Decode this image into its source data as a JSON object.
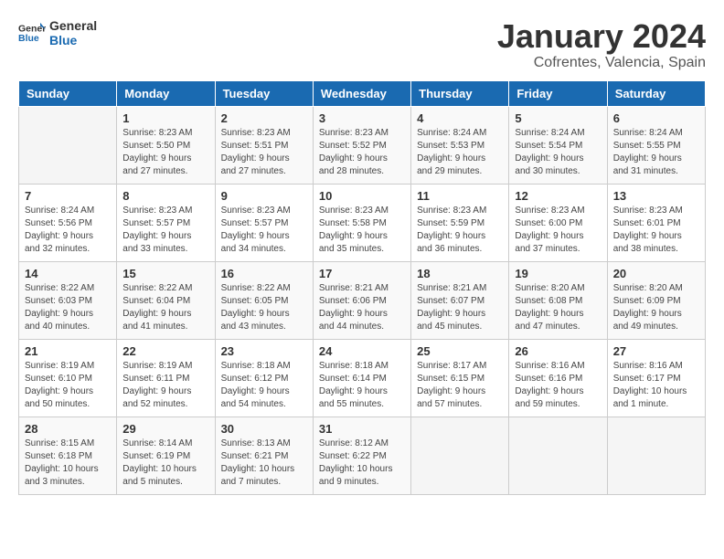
{
  "header": {
    "logo_line1": "General",
    "logo_line2": "Blue",
    "title": "January 2024",
    "subtitle": "Cofrentes, Valencia, Spain"
  },
  "columns": [
    "Sunday",
    "Monday",
    "Tuesday",
    "Wednesday",
    "Thursday",
    "Friday",
    "Saturday"
  ],
  "weeks": [
    [
      {
        "day": "",
        "info": ""
      },
      {
        "day": "1",
        "info": "Sunrise: 8:23 AM\nSunset: 5:50 PM\nDaylight: 9 hours\nand 27 minutes."
      },
      {
        "day": "2",
        "info": "Sunrise: 8:23 AM\nSunset: 5:51 PM\nDaylight: 9 hours\nand 27 minutes."
      },
      {
        "day": "3",
        "info": "Sunrise: 8:23 AM\nSunset: 5:52 PM\nDaylight: 9 hours\nand 28 minutes."
      },
      {
        "day": "4",
        "info": "Sunrise: 8:24 AM\nSunset: 5:53 PM\nDaylight: 9 hours\nand 29 minutes."
      },
      {
        "day": "5",
        "info": "Sunrise: 8:24 AM\nSunset: 5:54 PM\nDaylight: 9 hours\nand 30 minutes."
      },
      {
        "day": "6",
        "info": "Sunrise: 8:24 AM\nSunset: 5:55 PM\nDaylight: 9 hours\nand 31 minutes."
      }
    ],
    [
      {
        "day": "7",
        "info": "Sunrise: 8:24 AM\nSunset: 5:56 PM\nDaylight: 9 hours\nand 32 minutes."
      },
      {
        "day": "8",
        "info": "Sunrise: 8:23 AM\nSunset: 5:57 PM\nDaylight: 9 hours\nand 33 minutes."
      },
      {
        "day": "9",
        "info": "Sunrise: 8:23 AM\nSunset: 5:57 PM\nDaylight: 9 hours\nand 34 minutes."
      },
      {
        "day": "10",
        "info": "Sunrise: 8:23 AM\nSunset: 5:58 PM\nDaylight: 9 hours\nand 35 minutes."
      },
      {
        "day": "11",
        "info": "Sunrise: 8:23 AM\nSunset: 5:59 PM\nDaylight: 9 hours\nand 36 minutes."
      },
      {
        "day": "12",
        "info": "Sunrise: 8:23 AM\nSunset: 6:00 PM\nDaylight: 9 hours\nand 37 minutes."
      },
      {
        "day": "13",
        "info": "Sunrise: 8:23 AM\nSunset: 6:01 PM\nDaylight: 9 hours\nand 38 minutes."
      }
    ],
    [
      {
        "day": "14",
        "info": "Sunrise: 8:22 AM\nSunset: 6:03 PM\nDaylight: 9 hours\nand 40 minutes."
      },
      {
        "day": "15",
        "info": "Sunrise: 8:22 AM\nSunset: 6:04 PM\nDaylight: 9 hours\nand 41 minutes."
      },
      {
        "day": "16",
        "info": "Sunrise: 8:22 AM\nSunset: 6:05 PM\nDaylight: 9 hours\nand 43 minutes."
      },
      {
        "day": "17",
        "info": "Sunrise: 8:21 AM\nSunset: 6:06 PM\nDaylight: 9 hours\nand 44 minutes."
      },
      {
        "day": "18",
        "info": "Sunrise: 8:21 AM\nSunset: 6:07 PM\nDaylight: 9 hours\nand 45 minutes."
      },
      {
        "day": "19",
        "info": "Sunrise: 8:20 AM\nSunset: 6:08 PM\nDaylight: 9 hours\nand 47 minutes."
      },
      {
        "day": "20",
        "info": "Sunrise: 8:20 AM\nSunset: 6:09 PM\nDaylight: 9 hours\nand 49 minutes."
      }
    ],
    [
      {
        "day": "21",
        "info": "Sunrise: 8:19 AM\nSunset: 6:10 PM\nDaylight: 9 hours\nand 50 minutes."
      },
      {
        "day": "22",
        "info": "Sunrise: 8:19 AM\nSunset: 6:11 PM\nDaylight: 9 hours\nand 52 minutes."
      },
      {
        "day": "23",
        "info": "Sunrise: 8:18 AM\nSunset: 6:12 PM\nDaylight: 9 hours\nand 54 minutes."
      },
      {
        "day": "24",
        "info": "Sunrise: 8:18 AM\nSunset: 6:14 PM\nDaylight: 9 hours\nand 55 minutes."
      },
      {
        "day": "25",
        "info": "Sunrise: 8:17 AM\nSunset: 6:15 PM\nDaylight: 9 hours\nand 57 minutes."
      },
      {
        "day": "26",
        "info": "Sunrise: 8:16 AM\nSunset: 6:16 PM\nDaylight: 9 hours\nand 59 minutes."
      },
      {
        "day": "27",
        "info": "Sunrise: 8:16 AM\nSunset: 6:17 PM\nDaylight: 10 hours\nand 1 minute."
      }
    ],
    [
      {
        "day": "28",
        "info": "Sunrise: 8:15 AM\nSunset: 6:18 PM\nDaylight: 10 hours\nand 3 minutes."
      },
      {
        "day": "29",
        "info": "Sunrise: 8:14 AM\nSunset: 6:19 PM\nDaylight: 10 hours\nand 5 minutes."
      },
      {
        "day": "30",
        "info": "Sunrise: 8:13 AM\nSunset: 6:21 PM\nDaylight: 10 hours\nand 7 minutes."
      },
      {
        "day": "31",
        "info": "Sunrise: 8:12 AM\nSunset: 6:22 PM\nDaylight: 10 hours\nand 9 minutes."
      },
      {
        "day": "",
        "info": ""
      },
      {
        "day": "",
        "info": ""
      },
      {
        "day": "",
        "info": ""
      }
    ]
  ]
}
